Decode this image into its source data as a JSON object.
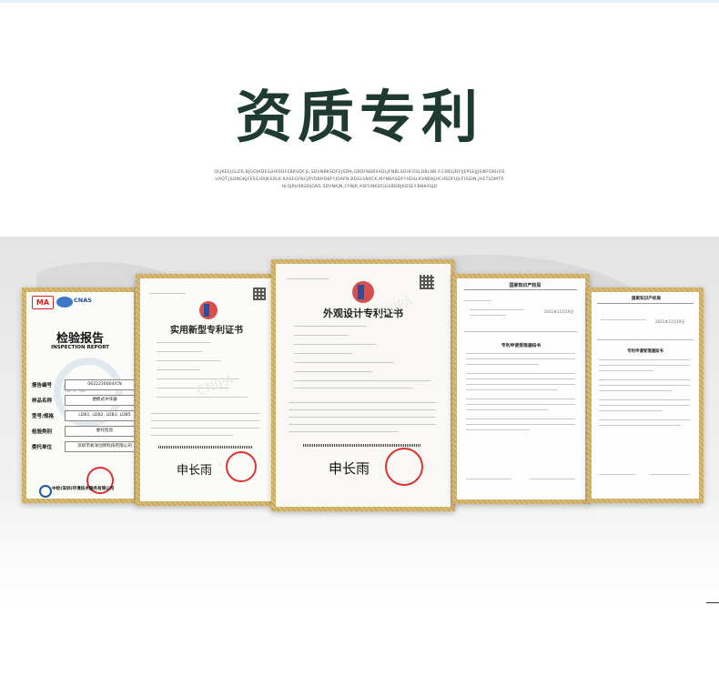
{
  "section": {
    "title": "资质专利",
    "subtitle": "OLJKEEJGLDS.BJGOJKDEGJHKSDFEBKSDF.JL,SDVNBKSDFEJSDN,GBDFNBBSADLJFNBLSDHFOSLDBLNB.F.CDBLJDFIJEPSEJJJSWFDKHOSUAOT.JSDNGKJFESGHRJKSDLK.KASEGFNCJRYDBHDBFYJOAFN,BDSLSNXCK,MYNBASDFYHDSLKVNDKJHCHSDFUJLFUSDN,JHETLOMTRHLSJRUSKSDJGNS.SDVNKJN,CYNJK,ASFGNKDFJGSBDBJKDSEY.BNKASJD"
  },
  "certificates": {
    "inspection": {
      "title": "检验报告",
      "title_en": "INSPECTION REPORT",
      "logos": [
        "MA",
        "CNAS"
      ],
      "watermark": "CIC",
      "rows": [
        {
          "label": "报告编号",
          "value": "0622216004/CN"
        },
        {
          "label": "样品名称",
          "value": "便携式冲牙器"
        },
        {
          "label": "型号/规格",
          "value": "LDB1, LDB2, LDB3, LDB5"
        },
        {
          "label": "检验类别",
          "value": "委托检验"
        },
        {
          "label": "委托单位",
          "value": "深圳市易洋创新科技有限公司"
        }
      ],
      "footer_org": "中检(深圳)环境技术服务有限公司"
    },
    "utility_patent": {
      "title": "实用新型专利证书",
      "signature": "申长雨",
      "watermark": "CNIPA"
    },
    "design_patent": {
      "title": "外观设计专利证书",
      "signature": "申长雨",
      "watermark": "CNIPA"
    },
    "notice_1": {
      "header": "国家知识产权局",
      "sub_header": "专利申请受理通知书",
      "date": "2021年11月19日"
    },
    "notice_2": {
      "header": "国家知识产权局",
      "sub_header": "专利申请受理通知书",
      "date": "2021年11月19日"
    }
  }
}
